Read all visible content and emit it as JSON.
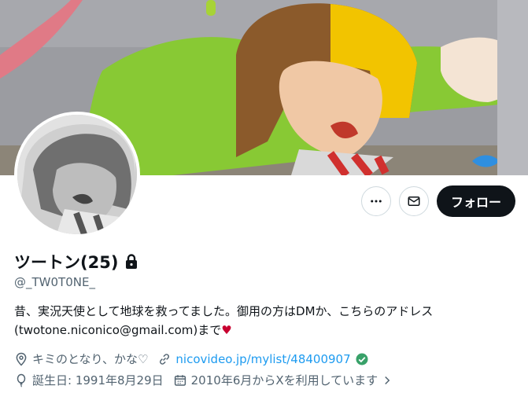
{
  "profile": {
    "name": "ツートン(25)",
    "handle": "@_TW0T0NE_",
    "bio_text": "昔、実況天使として地球を救ってました。御用の方はDMか、こちらのアドレス(twotone.niconico@gmail.com)まで",
    "bio_emoji": "♥",
    "location": "キミのとなり、かな♡",
    "website": "nicovideo.jp/mylist/48400907",
    "birthday": "誕生日: 1991年8月29日",
    "joined": "2010年6月からXを利用しています"
  },
  "actions": {
    "more_icon": "more-horizontal-icon",
    "message_icon": "envelope-icon",
    "follow_label": "フォロー"
  },
  "icons": {
    "lock": "lock-icon",
    "location": "location-pin-icon",
    "link": "link-icon",
    "verified": "verified-check-icon",
    "birthday": "balloon-icon",
    "calendar": "calendar-icon",
    "chevron": "chevron-right-icon"
  },
  "colors": {
    "accent": "#1d9bf0",
    "verified": "#38a169",
    "text_secondary": "#536471",
    "follow_bg": "#0f1419",
    "heart": "#c80030"
  }
}
